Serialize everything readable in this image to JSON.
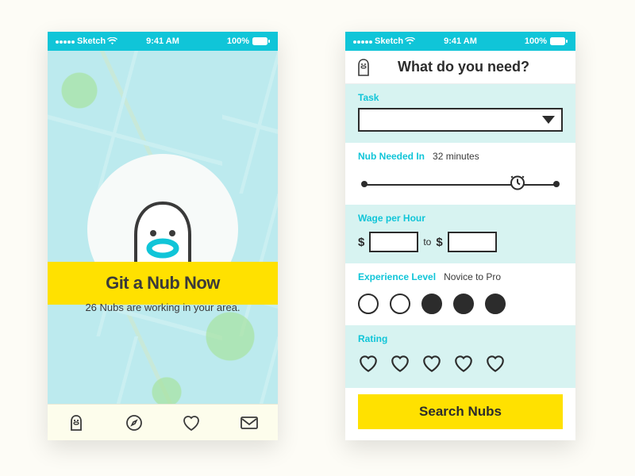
{
  "status": {
    "carrier": "Sketch",
    "time": "9:41 AM",
    "battery": "100%"
  },
  "left": {
    "cta": "Git a Nub Now",
    "subtext": "26 Nubs are working in your area."
  },
  "right": {
    "header": "What do you need?",
    "task": {
      "label": "Task"
    },
    "timing": {
      "label": "Nub Needed In",
      "value": "32 minutes"
    },
    "wage": {
      "label": "Wage per Hour",
      "joiner": "to"
    },
    "experience": {
      "label": "Experience Level",
      "value": "Novice to Pro",
      "filled": [
        false,
        false,
        true,
        true,
        true
      ]
    },
    "rating": {
      "label": "Rating"
    },
    "search": "Search Nubs"
  }
}
